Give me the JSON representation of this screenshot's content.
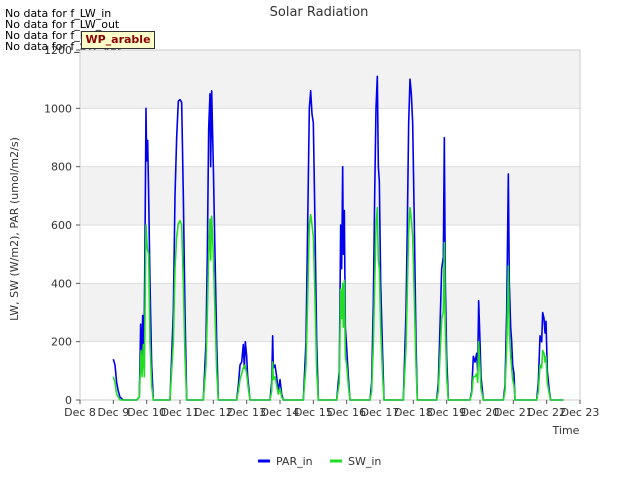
{
  "no_data_messages": [
    "No data for f_LW_in",
    "No data for f_LW_out",
    "No data for f_PAR_out",
    "No data for f_SW_out"
  ],
  "badge_label": "WP_arable",
  "colors": {
    "PAR_in": "#0000ee",
    "SW_in": "#22dd22",
    "band": "#f2f2f2",
    "grid": "#dddddd"
  },
  "chart_data": {
    "type": "line",
    "title": "Solar Radiation",
    "xlabel": "Time",
    "ylabel": "LW, SW (W/m2), PAR (umol/m2/s)",
    "xlim": [
      8,
      23
    ],
    "ylim": [
      0,
      1200
    ],
    "x_ticks": [
      8,
      9,
      10,
      11,
      12,
      13,
      14,
      15,
      16,
      17,
      18,
      19,
      20,
      21,
      22,
      23
    ],
    "x_tick_labels": [
      "Dec 8",
      "Dec 9",
      "Dec 10",
      "Dec 11",
      "Dec 12",
      "Dec 13",
      "Dec 14",
      "Dec 15",
      "Dec 16",
      "Dec 17",
      "Dec 18",
      "Dec 19",
      "Dec 20",
      "Dec 21",
      "Dec 22",
      "Dec 23"
    ],
    "y_ticks": [
      0,
      200,
      400,
      600,
      800,
      1000,
      1200
    ],
    "grid": true,
    "legend_position": "bottom-center",
    "series": [
      {
        "name": "PAR_in",
        "points": [
          [
            9.0,
            140
          ],
          [
            9.05,
            120
          ],
          [
            9.1,
            60
          ],
          [
            9.15,
            30
          ],
          [
            9.2,
            10
          ],
          [
            9.3,
            0
          ],
          [
            9.7,
            0
          ],
          [
            9.78,
            10
          ],
          [
            9.82,
            260
          ],
          [
            9.85,
            100
          ],
          [
            9.88,
            290
          ],
          [
            9.92,
            150
          ],
          [
            9.95,
            550
          ],
          [
            9.98,
            1000
          ],
          [
            10.0,
            820
          ],
          [
            10.03,
            890
          ],
          [
            10.06,
            700
          ],
          [
            10.1,
            400
          ],
          [
            10.15,
            120
          ],
          [
            10.2,
            0
          ],
          [
            10.7,
            0
          ],
          [
            10.8,
            300
          ],
          [
            10.85,
            700
          ],
          [
            10.9,
            900
          ],
          [
            10.95,
            1025
          ],
          [
            11.0,
            1030
          ],
          [
            11.05,
            1020
          ],
          [
            11.1,
            700
          ],
          [
            11.15,
            300
          ],
          [
            11.2,
            0
          ],
          [
            11.7,
            0
          ],
          [
            11.78,
            200
          ],
          [
            11.82,
            500
          ],
          [
            11.86,
            930
          ],
          [
            11.9,
            1050
          ],
          [
            11.92,
            800
          ],
          [
            11.95,
            1060
          ],
          [
            12.0,
            800
          ],
          [
            12.05,
            500
          ],
          [
            12.1,
            200
          ],
          [
            12.15,
            0
          ],
          [
            12.7,
            0
          ],
          [
            12.75,
            50
          ],
          [
            12.8,
            120
          ],
          [
            12.85,
            130
          ],
          [
            12.9,
            190
          ],
          [
            12.93,
            110
          ],
          [
            12.96,
            200
          ],
          [
            13.0,
            150
          ],
          [
            13.03,
            80
          ],
          [
            13.1,
            0
          ],
          [
            13.7,
            0
          ],
          [
            13.75,
            60
          ],
          [
            13.78,
            220
          ],
          [
            13.8,
            110
          ],
          [
            13.85,
            120
          ],
          [
            13.9,
            80
          ],
          [
            13.95,
            30
          ],
          [
            14.0,
            70
          ],
          [
            14.05,
            20
          ],
          [
            14.1,
            0
          ],
          [
            14.7,
            0
          ],
          [
            14.78,
            200
          ],
          [
            14.83,
            600
          ],
          [
            14.88,
            1000
          ],
          [
            14.92,
            1060
          ],
          [
            14.96,
            980
          ],
          [
            15.0,
            950
          ],
          [
            15.05,
            600
          ],
          [
            15.1,
            200
          ],
          [
            15.15,
            0
          ],
          [
            15.7,
            0
          ],
          [
            15.78,
            100
          ],
          [
            15.82,
            600
          ],
          [
            15.85,
            450
          ],
          [
            15.88,
            800
          ],
          [
            15.9,
            500
          ],
          [
            15.93,
            650
          ],
          [
            15.96,
            250
          ],
          [
            16.0,
            180
          ],
          [
            16.05,
            80
          ],
          [
            16.1,
            0
          ],
          [
            16.7,
            0
          ],
          [
            16.75,
            60
          ],
          [
            16.8,
            330
          ],
          [
            16.84,
            700
          ],
          [
            16.88,
            1000
          ],
          [
            16.92,
            1110
          ],
          [
            16.95,
            800
          ],
          [
            16.98,
            750
          ],
          [
            17.02,
            400
          ],
          [
            17.08,
            150
          ],
          [
            17.12,
            0
          ],
          [
            17.7,
            0
          ],
          [
            17.78,
            300
          ],
          [
            17.82,
            600
          ],
          [
            17.86,
            950
          ],
          [
            17.9,
            1100
          ],
          [
            17.94,
            1050
          ],
          [
            17.98,
            950
          ],
          [
            18.03,
            600
          ],
          [
            18.08,
            200
          ],
          [
            18.12,
            0
          ],
          [
            18.7,
            0
          ],
          [
            18.75,
            60
          ],
          [
            18.8,
            250
          ],
          [
            18.85,
            450
          ],
          [
            18.9,
            490
          ],
          [
            18.93,
            900
          ],
          [
            18.96,
            400
          ],
          [
            19.0,
            150
          ],
          [
            19.05,
            0
          ],
          [
            19.7,
            0
          ],
          [
            19.75,
            30
          ],
          [
            19.8,
            150
          ],
          [
            19.85,
            130
          ],
          [
            19.9,
            160
          ],
          [
            19.93,
            100
          ],
          [
            19.96,
            340
          ],
          [
            20.0,
            200
          ],
          [
            20.03,
            80
          ],
          [
            20.1,
            0
          ],
          [
            20.7,
            0
          ],
          [
            20.75,
            50
          ],
          [
            20.8,
            300
          ],
          [
            20.85,
            775
          ],
          [
            20.88,
            400
          ],
          [
            20.92,
            250
          ],
          [
            20.95,
            200
          ],
          [
            20.98,
            120
          ],
          [
            21.02,
            90
          ],
          [
            21.05,
            0
          ],
          [
            21.7,
            0
          ],
          [
            21.75,
            60
          ],
          [
            21.8,
            220
          ],
          [
            21.85,
            200
          ],
          [
            21.88,
            300
          ],
          [
            21.92,
            280
          ],
          [
            21.95,
            230
          ],
          [
            21.98,
            270
          ],
          [
            22.02,
            100
          ],
          [
            22.08,
            30
          ],
          [
            22.12,
            0
          ],
          [
            22.5,
            0
          ]
        ]
      },
      {
        "name": "SW_in",
        "points": [
          [
            9.0,
            80
          ],
          [
            9.05,
            60
          ],
          [
            9.1,
            20
          ],
          [
            9.15,
            10
          ],
          [
            9.2,
            0
          ],
          [
            9.7,
            0
          ],
          [
            9.78,
            10
          ],
          [
            9.83,
            170
          ],
          [
            9.86,
            80
          ],
          [
            9.9,
            190
          ],
          [
            9.93,
            80
          ],
          [
            9.96,
            400
          ],
          [
            9.98,
            600
          ],
          [
            10.02,
            520
          ],
          [
            10.06,
            500
          ],
          [
            10.1,
            200
          ],
          [
            10.15,
            50
          ],
          [
            10.2,
            0
          ],
          [
            10.7,
            0
          ],
          [
            10.8,
            200
          ],
          [
            10.85,
            450
          ],
          [
            10.9,
            560
          ],
          [
            10.95,
            605
          ],
          [
            11.0,
            615
          ],
          [
            11.05,
            600
          ],
          [
            11.1,
            400
          ],
          [
            11.15,
            150
          ],
          [
            11.2,
            0
          ],
          [
            11.7,
            0
          ],
          [
            11.78,
            120
          ],
          [
            11.82,
            300
          ],
          [
            11.86,
            500
          ],
          [
            11.9,
            620
          ],
          [
            11.92,
            480
          ],
          [
            11.95,
            630
          ],
          [
            12.0,
            500
          ],
          [
            12.05,
            300
          ],
          [
            12.1,
            100
          ],
          [
            12.15,
            0
          ],
          [
            12.7,
            0
          ],
          [
            12.75,
            30
          ],
          [
            12.8,
            70
          ],
          [
            12.85,
            90
          ],
          [
            12.9,
            110
          ],
          [
            12.95,
            120
          ],
          [
            13.0,
            90
          ],
          [
            13.05,
            40
          ],
          [
            13.1,
            0
          ],
          [
            13.7,
            0
          ],
          [
            13.75,
            30
          ],
          [
            13.78,
            130
          ],
          [
            13.8,
            70
          ],
          [
            13.85,
            80
          ],
          [
            13.9,
            50
          ],
          [
            13.95,
            20
          ],
          [
            14.0,
            40
          ],
          [
            14.05,
            10
          ],
          [
            14.1,
            0
          ],
          [
            14.7,
            0
          ],
          [
            14.78,
            120
          ],
          [
            14.83,
            350
          ],
          [
            14.88,
            600
          ],
          [
            14.92,
            635
          ],
          [
            14.96,
            600
          ],
          [
            15.0,
            560
          ],
          [
            15.05,
            350
          ],
          [
            15.1,
            100
          ],
          [
            15.15,
            0
          ],
          [
            15.7,
            0
          ],
          [
            15.78,
            60
          ],
          [
            15.82,
            380
          ],
          [
            15.85,
            280
          ],
          [
            15.88,
            400
          ],
          [
            15.9,
            250
          ],
          [
            15.93,
            410
          ],
          [
            15.96,
            150
          ],
          [
            16.0,
            120
          ],
          [
            16.05,
            50
          ],
          [
            16.1,
            0
          ],
          [
            16.7,
            0
          ],
          [
            16.75,
            30
          ],
          [
            16.8,
            190
          ],
          [
            16.84,
            400
          ],
          [
            16.88,
            600
          ],
          [
            16.92,
            660
          ],
          [
            16.95,
            480
          ],
          [
            16.98,
            450
          ],
          [
            17.02,
            250
          ],
          [
            17.08,
            80
          ],
          [
            17.12,
            0
          ],
          [
            17.7,
            0
          ],
          [
            17.78,
            180
          ],
          [
            17.82,
            380
          ],
          [
            17.86,
            580
          ],
          [
            17.9,
            660
          ],
          [
            17.94,
            620
          ],
          [
            17.98,
            560
          ],
          [
            18.03,
            350
          ],
          [
            18.08,
            120
          ],
          [
            18.12,
            0
          ],
          [
            18.7,
            0
          ],
          [
            18.75,
            30
          ],
          [
            18.8,
            150
          ],
          [
            18.85,
            280
          ],
          [
            18.9,
            300
          ],
          [
            18.93,
            540
          ],
          [
            18.96,
            250
          ],
          [
            19.0,
            80
          ],
          [
            19.05,
            0
          ],
          [
            19.7,
            0
          ],
          [
            19.75,
            20
          ],
          [
            19.8,
            80
          ],
          [
            19.85,
            80
          ],
          [
            19.9,
            90
          ],
          [
            19.93,
            60
          ],
          [
            19.96,
            200
          ],
          [
            20.0,
            110
          ],
          [
            20.03,
            40
          ],
          [
            20.1,
            0
          ],
          [
            20.7,
            0
          ],
          [
            20.75,
            30
          ],
          [
            20.8,
            180
          ],
          [
            20.85,
            460
          ],
          [
            20.88,
            240
          ],
          [
            20.92,
            150
          ],
          [
            20.95,
            110
          ],
          [
            20.98,
            70
          ],
          [
            21.02,
            50
          ],
          [
            21.05,
            0
          ],
          [
            21.7,
            0
          ],
          [
            21.75,
            30
          ],
          [
            21.8,
            120
          ],
          [
            21.85,
            110
          ],
          [
            21.88,
            170
          ],
          [
            21.92,
            160
          ],
          [
            21.95,
            130
          ],
          [
            21.98,
            150
          ],
          [
            22.02,
            60
          ],
          [
            22.08,
            20
          ],
          [
            22.12,
            0
          ],
          [
            22.5,
            0
          ]
        ]
      }
    ]
  }
}
